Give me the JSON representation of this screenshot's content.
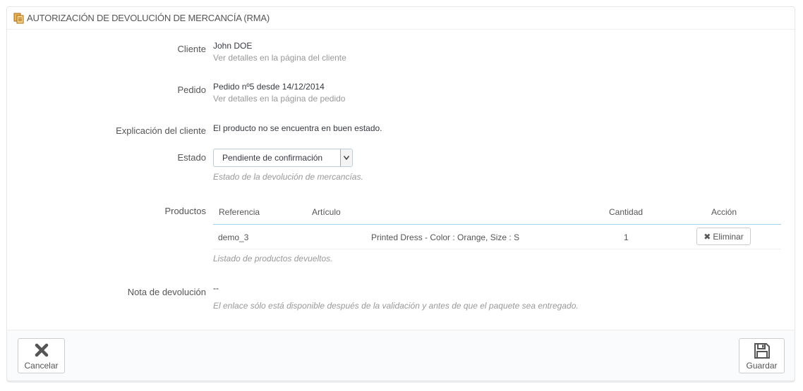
{
  "panel": {
    "title": "AUTORIZACIÓN DE DEVOLUCIÓN DE MERCANCÍA (RMA)"
  },
  "customer": {
    "label": "Cliente",
    "name": "John DOE",
    "link": "Ver detalles en la página del cliente"
  },
  "order": {
    "label": "Pedido",
    "value": "Pedido nº5 desde 14/12/2014",
    "link": "Ver detalles en la página de pedido"
  },
  "explanation": {
    "label": "Explicación del cliente",
    "value": "El producto no se encuentra en buen estado."
  },
  "status": {
    "label": "Estado",
    "selected": "Pendiente de confirmación",
    "help": "Estado de la devolución de mercancías."
  },
  "products": {
    "label": "Productos",
    "headers": {
      "reference": "Referencia",
      "article": "Artículo",
      "quantity": "Cantidad",
      "action": "Acción"
    },
    "rows": [
      {
        "reference": "demo_3",
        "article": "Printed Dress - Color : Orange, Size : S",
        "quantity": "1",
        "action": "Eliminar"
      }
    ],
    "help": "Listado de productos devueltos."
  },
  "return_note": {
    "label": "Nota de devolución",
    "value": "--",
    "help": "El enlace sólo está disponible después de la validación y antes de que el paquete sea entregado."
  },
  "footer": {
    "cancel_label": "Cancelar",
    "save_label": "Guardar"
  },
  "icons": {
    "title": "copy-icon",
    "select_arrow": "chevron-down-icon",
    "delete": "times-icon",
    "cancel": "close-icon",
    "save": "floppy-disk-icon"
  }
}
